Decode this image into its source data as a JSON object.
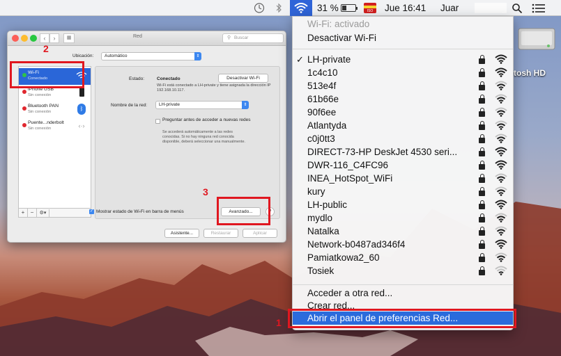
{
  "menubar": {
    "battery": "31 %",
    "clock": "Jue 16:41",
    "user": "Juar",
    "flag_text": "ISO"
  },
  "desktop": {
    "hd_label": "tosh HD"
  },
  "window": {
    "title": "Red",
    "search_placeholder": "Buscar",
    "location_label": "Ubicación:",
    "location_value": "Automático",
    "services": [
      {
        "name": "Wi-Fi",
        "status": "Conectado",
        "dot": "#2ec24a"
      },
      {
        "name": "iPhone USB",
        "status": "Sin conexión",
        "dot": "#e0282f"
      },
      {
        "name": "Bluetooth PAN",
        "status": "Sin conexión",
        "dot": "#e0282f"
      },
      {
        "name": "Puente...nderbolt",
        "status": "Sin conexión",
        "dot": "#e0282f"
      }
    ],
    "status_label": "Estado:",
    "status_value": "Conectado",
    "disable_wifi_button": "Desactivar Wi-Fi",
    "status_description": "Wi-Fi está conectado a LH-private y tiene asignada la dirección IP 192.168.10.117.",
    "network_name_label": "Nombre de la red:",
    "network_name_value": "LH-private",
    "ask_join_label": "Preguntar antes de acceder a nuevas redes",
    "ask_join_description": "Se accederá automáticamente a las redes conocidas. Si no hay ninguna red conocida disponible, deberá seleccionar una manualmente.",
    "show_status_label": "Mostrar estado de Wi-Fi en barra de menús",
    "advanced_button": "Avanzado...",
    "help_button": "?",
    "assistant_button": "Asistente...",
    "revert_button": "Restaurar",
    "apply_button": "Aplicar"
  },
  "menu": {
    "wifi_status": "Wi-Fi: activado",
    "turn_off": "Desactivar Wi-Fi",
    "networks": [
      {
        "name": "LH-private",
        "checked": true,
        "bars": 3
      },
      {
        "name": "1c4c10",
        "checked": false,
        "bars": 3
      },
      {
        "name": "513e4f",
        "checked": false,
        "bars": 2
      },
      {
        "name": "61b66e",
        "checked": false,
        "bars": 2
      },
      {
        "name": "90f6ee",
        "checked": false,
        "bars": 2
      },
      {
        "name": "Atlantyda",
        "checked": false,
        "bars": 2
      },
      {
        "name": "c0j0tt3",
        "checked": false,
        "bars": 2
      },
      {
        "name": "DIRECT-73-HP DeskJet 4530 seri...",
        "checked": false,
        "bars": 3
      },
      {
        "name": "DWR-116_C4FC96",
        "checked": false,
        "bars": 3
      },
      {
        "name": "INEA_HotSpot_WiFi",
        "checked": false,
        "bars": 2
      },
      {
        "name": "kury",
        "checked": false,
        "bars": 2
      },
      {
        "name": "LH-public",
        "checked": false,
        "bars": 3
      },
      {
        "name": "mydlo",
        "checked": false,
        "bars": 2
      },
      {
        "name": "Natalka",
        "checked": false,
        "bars": 2
      },
      {
        "name": "Network-b0487ad346f4",
        "checked": false,
        "bars": 3
      },
      {
        "name": "Pamiatkowa2_60",
        "checked": false,
        "bars": 2
      },
      {
        "name": "Tosiek",
        "checked": false,
        "bars": 1
      }
    ],
    "join_other": "Acceder a otra red...",
    "create_network": "Crear red...",
    "open_prefs": "Abrir el panel de preferencias Red..."
  },
  "annotations": {
    "one": "1",
    "two": "2",
    "three": "3"
  },
  "colors": {
    "highlight": "#2b6bdc",
    "annotation": "#e01720",
    "wifi_selected": "#1a78f0"
  }
}
